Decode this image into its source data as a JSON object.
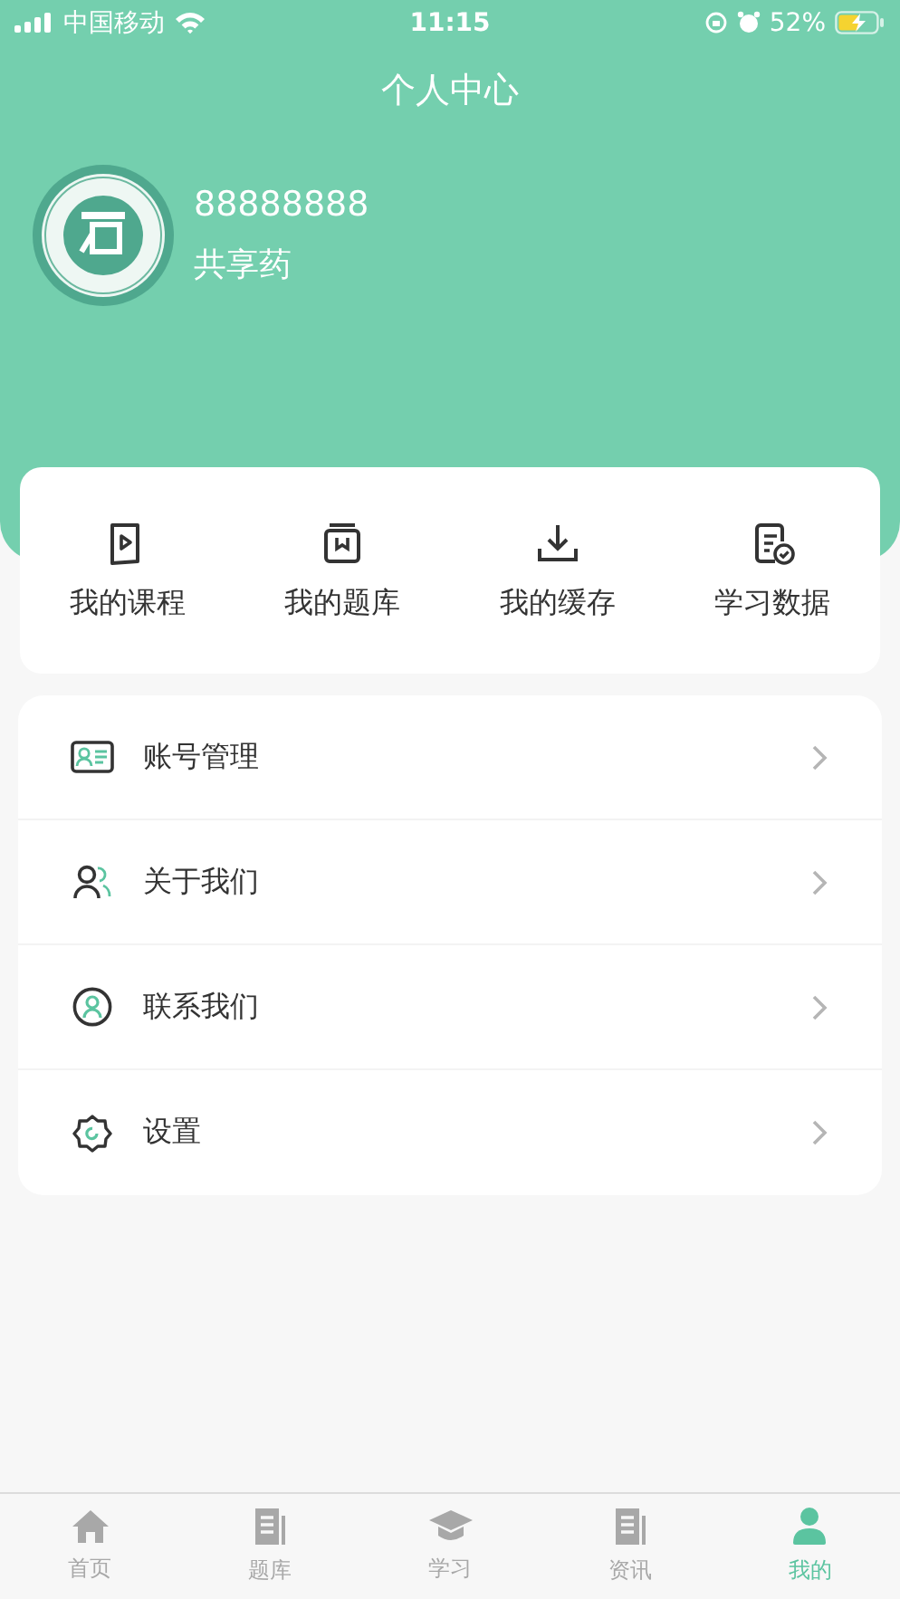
{
  "status_bar": {
    "carrier": "中国移动",
    "time": "11:15",
    "battery": "52%"
  },
  "header": {
    "title": "个人中心"
  },
  "profile": {
    "id": "88888888",
    "name": "共享药"
  },
  "shortcuts": [
    {
      "label": "我的课程"
    },
    {
      "label": "我的题库"
    },
    {
      "label": "我的缓存"
    },
    {
      "label": "学习数据"
    }
  ],
  "menu": [
    {
      "label": "账号管理"
    },
    {
      "label": "关于我们"
    },
    {
      "label": "联系我们"
    },
    {
      "label": "设置"
    }
  ],
  "tabs": [
    {
      "label": "首页",
      "selected": false
    },
    {
      "label": "题库",
      "selected": false
    },
    {
      "label": "学习",
      "selected": false
    },
    {
      "label": "资讯",
      "selected": false
    },
    {
      "label": "我的",
      "selected": true
    }
  ]
}
